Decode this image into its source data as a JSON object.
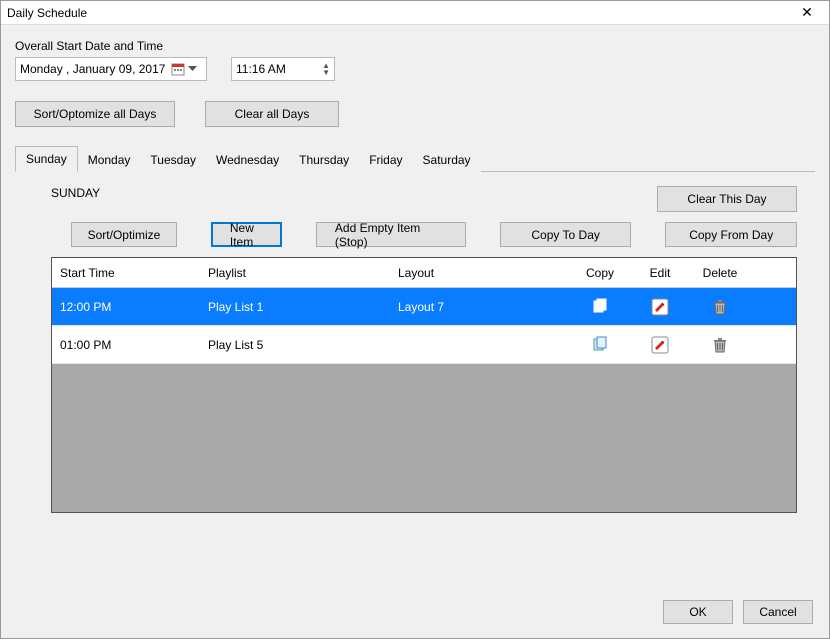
{
  "window": {
    "title": "Daily Schedule"
  },
  "overall": {
    "label": "Overall Start Date and Time",
    "date": "Monday   ,   January   09, 2017",
    "time": "11:16 AM"
  },
  "toolbar": {
    "sort_all": "Sort/Optomize all Days",
    "clear_all": "Clear all Days"
  },
  "tabs": [
    "Sunday",
    "Monday",
    "Tuesday",
    "Wednesday",
    "Thursday",
    "Friday",
    "Saturday"
  ],
  "active_tab": 0,
  "day": {
    "title": "SUNDAY",
    "clear": "Clear This Day",
    "sort": "Sort/Optimize",
    "new_item": "New Item",
    "add_empty": "Add Empty Item (Stop)",
    "copy_to": "Copy To Day",
    "copy_from": "Copy From Day"
  },
  "grid": {
    "headers": {
      "start": "Start Time",
      "playlist": "Playlist",
      "layout": "Layout",
      "copy": "Copy",
      "edit": "Edit",
      "del": "Delete"
    },
    "rows": [
      {
        "start": "12:00 PM",
        "playlist": "Play List 1",
        "layout": "Layout 7",
        "selected": true
      },
      {
        "start": "01:00 PM",
        "playlist": "Play List 5",
        "layout": "",
        "selected": false
      }
    ]
  },
  "footer": {
    "ok": "OK",
    "cancel": "Cancel"
  }
}
